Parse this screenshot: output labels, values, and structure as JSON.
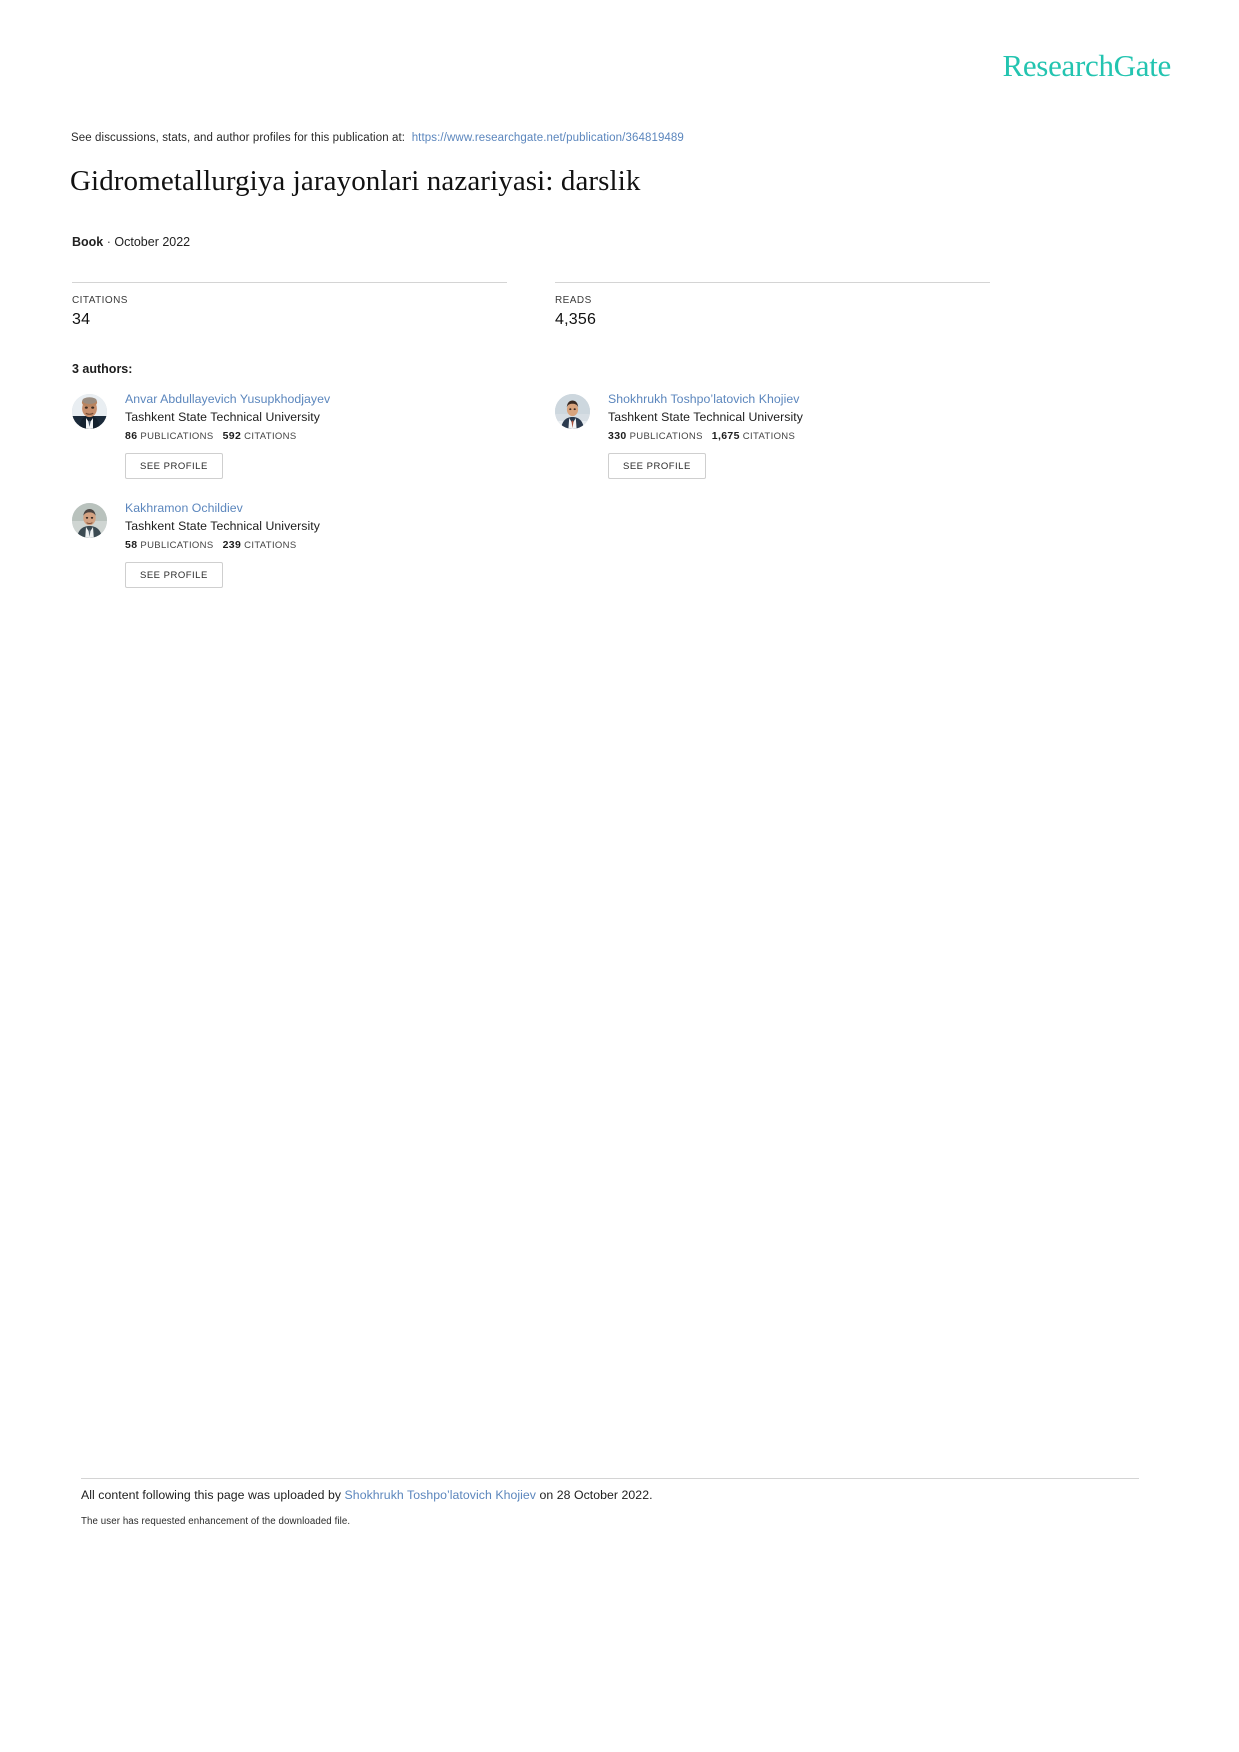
{
  "brand": {
    "name": "ResearchGate",
    "color": "#23c4b0"
  },
  "discussion": {
    "prefix": "See discussions, stats, and author profiles for this publication at:",
    "url": "https://www.researchgate.net/publication/364819489"
  },
  "publication": {
    "title": "Gidrometallurgiya jarayonlari nazariyasi: darslik",
    "type": "Book",
    "separator": "·",
    "date": "October 2022"
  },
  "metrics": [
    {
      "label": "CITATIONS",
      "value": "34"
    },
    {
      "label": "READS",
      "value": "4,356"
    }
  ],
  "authors_section": {
    "count_label": "3 authors:",
    "see_profile_label": "SEE PROFILE",
    "publications_label": "PUBLICATIONS",
    "citations_label": "CITATIONS"
  },
  "authors": [
    {
      "name": "Anvar Abdullayevich Yusupkhodjayev",
      "affiliation": "Tashkent State Technical University",
      "publications": "86",
      "citations": "592",
      "avatar": "author-photo-1"
    },
    {
      "name": "Shokhrukh Toshpo’latovich Khojiev",
      "affiliation": "Tashkent State Technical University",
      "publications": "330",
      "citations": "1,675",
      "avatar": "author-photo-2"
    },
    {
      "name": "Kakhramon Ochildiev",
      "affiliation": "Tashkent State Technical University",
      "publications": "58",
      "citations": "239",
      "avatar": "author-photo-3"
    }
  ],
  "footer": {
    "prefix": "All content following this page was uploaded by",
    "uploader": "Shokhrukh Toshpo’latovich Khojiev",
    "suffix": "on 28 October 2022.",
    "note": "The user has requested enhancement of the downloaded file."
  }
}
